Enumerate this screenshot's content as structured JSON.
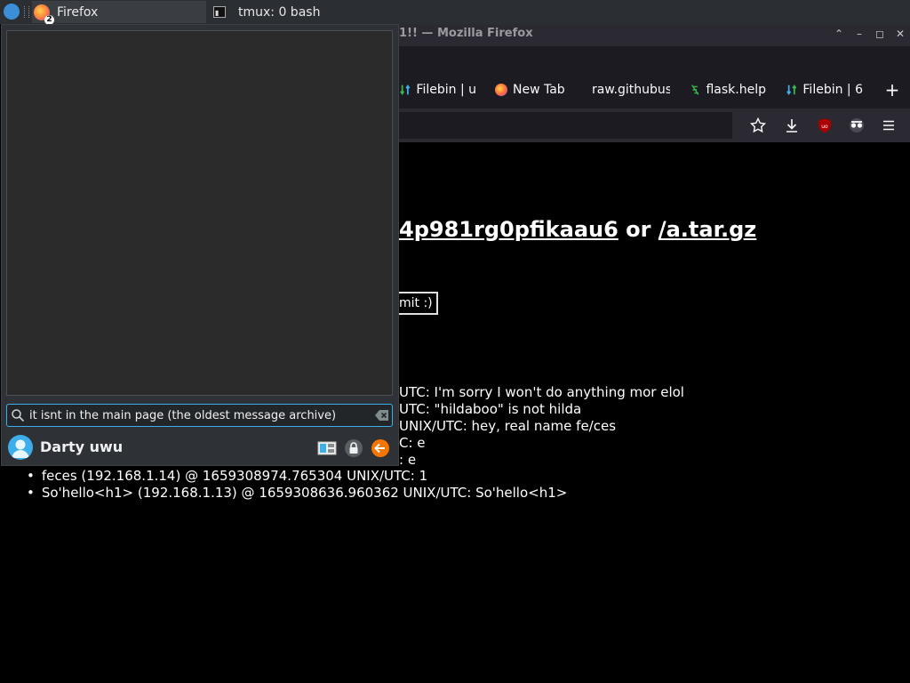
{
  "taskbar": {
    "tasks": [
      {
        "label": "Firefox",
        "badge": "2",
        "icon": "firefox-icon"
      },
      {
        "label": "tmux: 0 bash",
        "icon": "terminal-icon"
      }
    ]
  },
  "browser": {
    "window_title": "1!! — Mozilla Firefox",
    "window_buttons": {
      "maximize": "⌃",
      "minimize": "–",
      "restore": "◻",
      "close": "✕"
    },
    "tabs": [
      {
        "label": "Filebin | u",
        "icon": "filebin-icon"
      },
      {
        "label": "New Tab",
        "icon": "firefox-icon"
      },
      {
        "label": "raw.githubus",
        "icon": ""
      },
      {
        "label": "flask.help",
        "icon": "flask-icon"
      },
      {
        "label": "Filebin | 6",
        "icon": "filebin-icon"
      }
    ],
    "new_tab_label": "+",
    "toolbar_icons": [
      "bookmark-star-icon",
      "download-icon",
      "ublock-icon",
      "private-mask-icon",
      "hamburger-menu-icon"
    ]
  },
  "page": {
    "heading_link1": "4p981rg0pfikaau6",
    "heading_or": " or ",
    "heading_link2": "/a.tar.gz",
    "submit_label": "mit :)",
    "partial_messages": [
      "UTC: I'm sorry I won't do anything mor elol",
      "UTC: \"hildaboo\" is not hilda",
      "UNIX/UTC: hey, real name fe/ces",
      "C: e",
      ": e"
    ],
    "messages": [
      "feces (192.168.1.14) @ 1659308974.765304 UNIX/UTC: 1",
      "So'hello<h1> (192.168.1.13) @ 1659308636.960362 UNIX/UTC: So'hello<h1>"
    ]
  },
  "chat": {
    "input_value": "it isnt in the main page (the oldest message archive)",
    "username": "Darty uwu",
    "accent": "#3daee9"
  }
}
